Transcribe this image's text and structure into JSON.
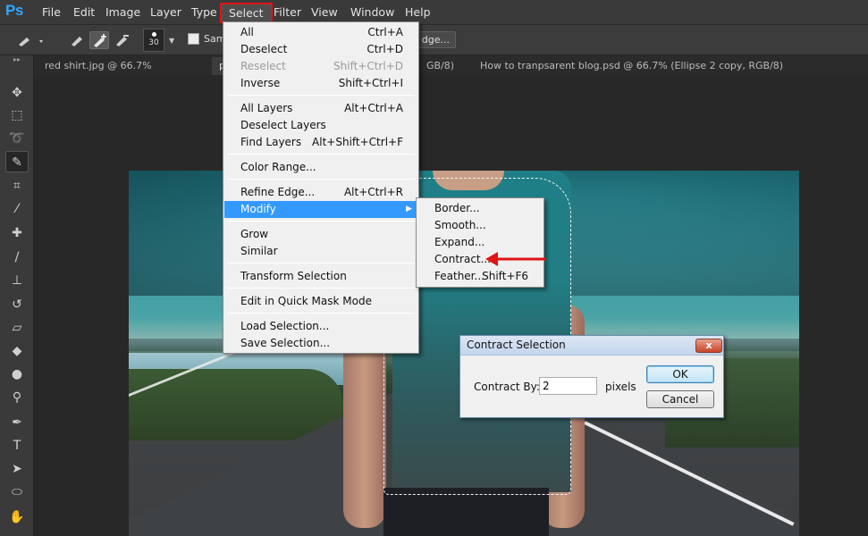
{
  "app": {
    "logo": "Ps"
  },
  "menubar": {
    "items": [
      {
        "label": "File"
      },
      {
        "label": "Edit"
      },
      {
        "label": "Image"
      },
      {
        "label": "Layer"
      },
      {
        "label": "Type"
      },
      {
        "label": "Select"
      },
      {
        "label": "Filter"
      },
      {
        "label": "View"
      },
      {
        "label": "Window"
      },
      {
        "label": "Help"
      }
    ],
    "active": "Select"
  },
  "options": {
    "brush_size": "30",
    "sample_label": "Sam",
    "refine_label": "dge..."
  },
  "tabs": [
    {
      "label": "red shirt.jpg @ 66.7% (RGB/8#)",
      "close": "×"
    },
    {
      "label": "p",
      "close": ""
    },
    {
      "label": "GB/8) *",
      "close": "×"
    },
    {
      "label": "How to tranpsarent blog.psd @ 66.7% (Ellipse 2 copy, RGB/8) *",
      "close": "×"
    }
  ],
  "tools": [
    {
      "icon": "move-icon",
      "glyph": "✥"
    },
    {
      "icon": "marquee-icon",
      "glyph": "⬚"
    },
    {
      "icon": "lasso-icon",
      "glyph": "➰"
    },
    {
      "icon": "quick-selection-icon",
      "glyph": "✎"
    },
    {
      "icon": "crop-icon",
      "glyph": "⌗"
    },
    {
      "icon": "eyedropper-icon",
      "glyph": "⁄"
    },
    {
      "icon": "healing-brush-icon",
      "glyph": "✚"
    },
    {
      "icon": "brush-icon",
      "glyph": "∕"
    },
    {
      "icon": "clone-stamp-icon",
      "glyph": "⊥"
    },
    {
      "icon": "history-brush-icon",
      "glyph": "↺"
    },
    {
      "icon": "eraser-icon",
      "glyph": "▱"
    },
    {
      "icon": "paint-bucket-icon",
      "glyph": "◆"
    },
    {
      "icon": "blur-icon",
      "glyph": "●"
    },
    {
      "icon": "dodge-icon",
      "glyph": "⚲"
    },
    {
      "icon": "pen-icon",
      "glyph": "✒"
    },
    {
      "icon": "type-icon",
      "glyph": "T"
    },
    {
      "icon": "path-selection-icon",
      "glyph": "➤"
    },
    {
      "icon": "ellipse-icon",
      "glyph": "⬭"
    },
    {
      "icon": "hand-icon",
      "glyph": "✋"
    }
  ],
  "select_menu": {
    "all": {
      "label": "All",
      "shortcut": "Ctrl+A"
    },
    "deselect": {
      "label": "Deselect",
      "shortcut": "Ctrl+D"
    },
    "reselect": {
      "label": "Reselect",
      "shortcut": "Shift+Ctrl+D"
    },
    "inverse": {
      "label": "Inverse",
      "shortcut": "Shift+Ctrl+I"
    },
    "all_layers": {
      "label": "All Layers",
      "shortcut": "Alt+Ctrl+A"
    },
    "deselect_layers": {
      "label": "Deselect Layers",
      "shortcut": ""
    },
    "find_layers": {
      "label": "Find Layers",
      "shortcut": "Alt+Shift+Ctrl+F"
    },
    "color_range": {
      "label": "Color Range...",
      "shortcut": ""
    },
    "refine_edge": {
      "label": "Refine Edge...",
      "shortcut": "Alt+Ctrl+R"
    },
    "modify": {
      "label": "Modify",
      "arrow": "▶"
    },
    "grow": {
      "label": "Grow",
      "shortcut": ""
    },
    "similar": {
      "label": "Similar",
      "shortcut": ""
    },
    "transform_selection": {
      "label": "Transform Selection",
      "shortcut": ""
    },
    "quick_mask": {
      "label": "Edit in Quick Mask Mode",
      "shortcut": ""
    },
    "load_selection": {
      "label": "Load Selection...",
      "shortcut": ""
    },
    "save_selection": {
      "label": "Save Selection...",
      "shortcut": ""
    }
  },
  "modify_submenu": {
    "border": {
      "label": "Border...",
      "shortcut": ""
    },
    "smooth": {
      "label": "Smooth...",
      "shortcut": ""
    },
    "expand": {
      "label": "Expand...",
      "shortcut": ""
    },
    "contract": {
      "label": "Contract...",
      "shortcut": ""
    },
    "feather": {
      "label": "Feather...",
      "shortcut": "Shift+F6"
    }
  },
  "dialog": {
    "title": "Contract Selection",
    "close": "x",
    "label": "Contract By:",
    "value": "2",
    "unit": "pixels",
    "ok": "OK",
    "cancel": "Cancel"
  },
  "colors": {
    "highlight": "#3399ff",
    "annotation": "#e01515",
    "ps_blue": "#31a8ff"
  }
}
